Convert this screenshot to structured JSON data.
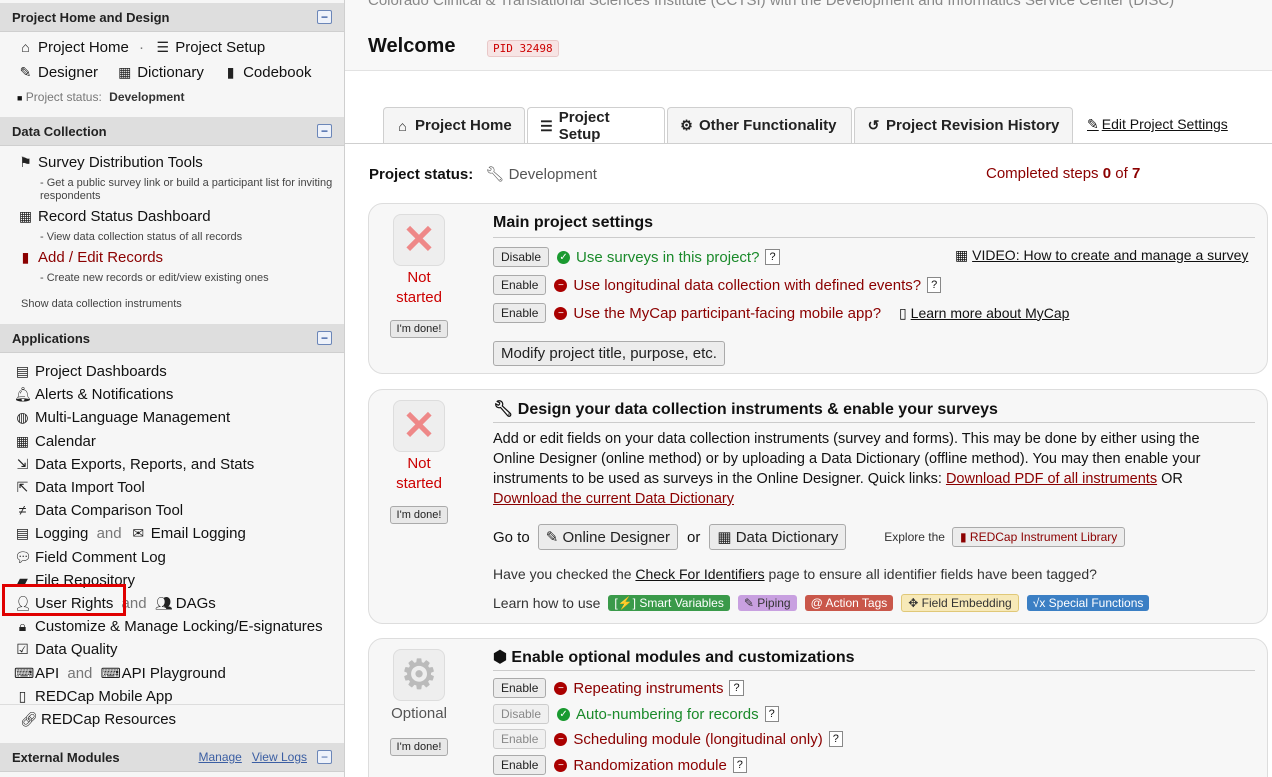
{
  "sidebar": {
    "project_home_design": {
      "header": "Project Home and Design",
      "project_home": "Project Home",
      "project_setup": "Project Setup",
      "designer": "Designer",
      "dictionary": "Dictionary",
      "codebook": "Codebook",
      "status_label": "Project status:",
      "status_value": "Development"
    },
    "data_collection": {
      "header": "Data Collection",
      "survey_tools": "Survey Distribution Tools",
      "survey_tools_desc": "- Get a public survey link or build a participant list for inviting respondents",
      "record_status": "Record Status Dashboard",
      "record_status_desc": "- View data collection status of all records",
      "add_edit": "Add / Edit Records",
      "add_edit_desc": "- Create new records or edit/view existing ones",
      "show_instruments": "Show data collection instruments"
    },
    "applications": {
      "header": "Applications",
      "project_dashboards": "Project Dashboards",
      "alerts": "Alerts & Notifications",
      "multilang": "Multi-Language Management",
      "calendar": "Calendar",
      "data_exports": "Data Exports, Reports, and Stats",
      "data_import": "Data Import Tool",
      "data_comparison": "Data Comparison Tool",
      "logging": "Logging",
      "and": "and",
      "email_logging": "Email Logging",
      "field_comment": "Field Comment Log",
      "file_repo": "File Repository",
      "user_rights": "User Rights",
      "and2": "and",
      "dags": "DAGs",
      "locking": "Customize & Manage Locking/E-signatures",
      "data_quality": "Data Quality",
      "api": "API",
      "and3": "and",
      "api_playground": "API Playground",
      "mobile_app": "REDCap Mobile App"
    },
    "resources": "REDCap Resources",
    "external_modules": {
      "header": "External Modules",
      "manage": "Manage",
      "view_logs": "View Logs"
    }
  },
  "main": {
    "institution": "Colorado Clinical & Translational Sciences Institute (CCTSI) with the Development and Informatics Service Center (DISC)",
    "welcome": "Welcome",
    "pid": "PID 32498",
    "tabs": {
      "home": "Project Home",
      "setup": "Project Setup",
      "other": "Other Functionality",
      "revision": "Project Revision History",
      "edit_settings": "Edit Project Settings"
    },
    "status_label": "Project status:",
    "status_value": "Development",
    "completed_prefix": "Completed steps",
    "completed_num": "0",
    "completed_of": "of",
    "completed_total": "7",
    "card1": {
      "status": "Not started",
      "done": "I'm done!",
      "title": "Main project settings",
      "surveys_btn": "Disable",
      "surveys": "Use surveys in this project?",
      "video": "VIDEO: How to create and manage a survey",
      "long_btn": "Enable",
      "long": "Use longitudinal data collection with defined events?",
      "mycap_btn": "Enable",
      "mycap": "Use the MyCap participant-facing mobile app?",
      "mycap_link": "Learn more about MyCap",
      "modify": "Modify project title, purpose, etc."
    },
    "card2": {
      "status": "Not started",
      "done": "I'm done!",
      "title": "Design your data collection instruments & enable your surveys",
      "desc1": "Add or edit fields on your data collection instruments (survey and forms). This may be done by either using the",
      "desc2": "Online Designer (online method) or by uploading a Data Dictionary (offline method). You may then enable your",
      "desc3": "instruments to be used as surveys in the Online Designer. Quick links:",
      "pdf_link": "Download PDF of all instruments",
      "or": "OR",
      "dict_link": "Download the current Data Dictionary",
      "goto": "Go to",
      "online_designer": "Online Designer",
      "or2": "or",
      "data_dictionary": "Data Dictionary",
      "explore": "Explore the",
      "library": "REDCap Instrument Library",
      "check_pre": "Have you checked the",
      "check_link": "Check For Identifiers",
      "check_post": "page to ensure all identifier fields have been tagged?",
      "learn": "Learn how to use",
      "smart": "[⚡] Smart Variables",
      "piping": "Piping",
      "action_tags": "@ Action Tags",
      "embedding": "Field Embedding",
      "special": "√x Special Functions"
    },
    "card3": {
      "status": "Optional",
      "done": "I'm done!",
      "title": "Enable optional modules and customizations",
      "repeat_btn": "Enable",
      "repeat": "Repeating instruments",
      "auto_btn": "Disable",
      "auto": "Auto-numbering for records",
      "sched_btn": "Enable",
      "sched": "Scheduling module (longitudinal only)",
      "rand_btn": "Enable",
      "rand": "Randomization module"
    }
  }
}
